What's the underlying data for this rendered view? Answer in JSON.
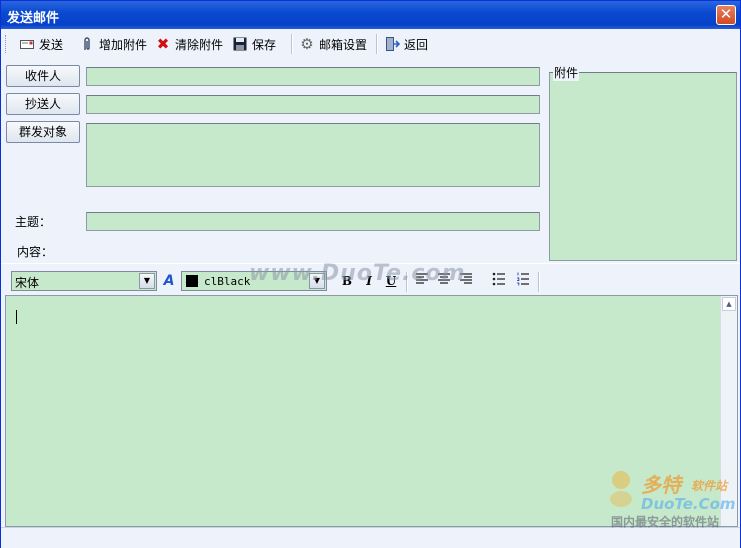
{
  "window": {
    "title": "发送邮件"
  },
  "toolbar": {
    "send": "发送",
    "add_attachment": "增加附件",
    "clear_attachments": "清除附件",
    "save": "保存",
    "mail_settings": "邮箱设置",
    "back": "返回"
  },
  "recipients": {
    "to_button": "收件人",
    "cc_button": "抄送人",
    "group_button": "群发对象",
    "to_value": "",
    "cc_value": "",
    "group_value": ""
  },
  "form": {
    "subject_label": "主题：",
    "content_label": "内容：",
    "subject_value": ""
  },
  "attachments": {
    "legend": "附件"
  },
  "format": {
    "font": "宋体",
    "color_name": "clBlack",
    "bold": "B",
    "italic": "I",
    "underline": "U"
  },
  "editor": {
    "body": ""
  },
  "watermarks": {
    "center": "www.DuoTe.com",
    "logo_brand": "多特",
    "logo_sub": "软件站",
    "logo_domain": "DuoTe.Com",
    "logo_tagline": "国内最安全的软件站"
  },
  "colors": {
    "field_bg": "#c7e9cb",
    "title_bar": "#0a4ad0",
    "client_bg": "#eef3fb"
  }
}
